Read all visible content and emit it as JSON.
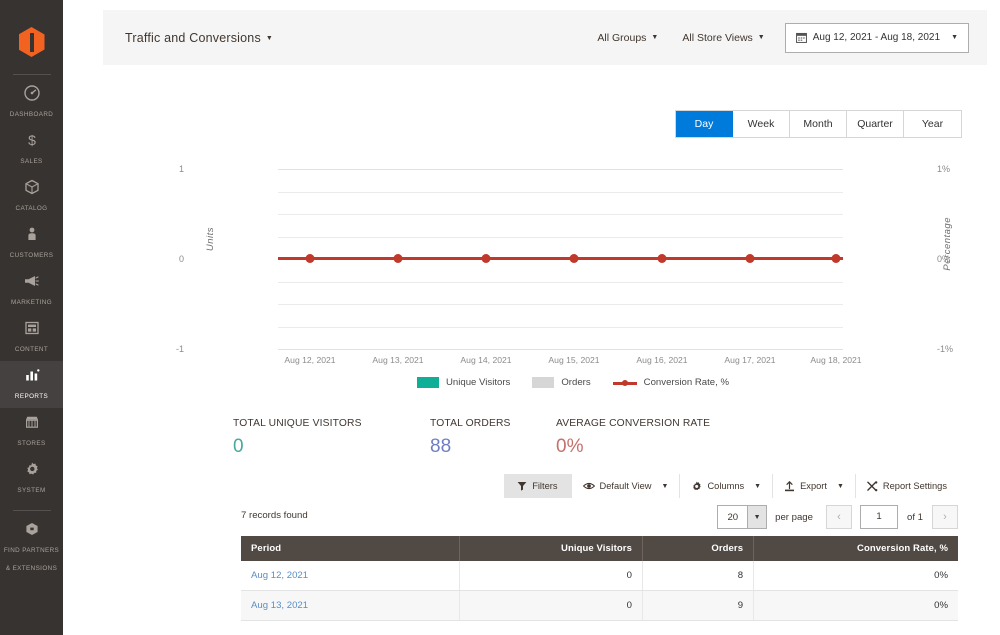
{
  "sidebar": {
    "logo": "magento-logo",
    "items": [
      {
        "label": "DASHBOARD",
        "icon": "dashboard-icon",
        "active": false
      },
      {
        "label": "SALES",
        "icon": "sales-icon",
        "active": false
      },
      {
        "label": "CATALOG",
        "icon": "catalog-icon",
        "active": false
      },
      {
        "label": "CUSTOMERS",
        "icon": "customers-icon",
        "active": false
      },
      {
        "label": "MARKETING",
        "icon": "marketing-icon",
        "active": false
      },
      {
        "label": "CONTENT",
        "icon": "content-icon",
        "active": false
      },
      {
        "label": "REPORTS",
        "icon": "reports-icon",
        "active": true
      },
      {
        "label": "STORES",
        "icon": "stores-icon",
        "active": false
      },
      {
        "label": "SYSTEM",
        "icon": "system-icon",
        "active": false
      },
      {
        "label": "FIND PARTNERS\n& EXTENSIONS",
        "icon": "partners-icon",
        "active": false
      }
    ]
  },
  "header": {
    "title": "Traffic and Conversions",
    "groups_label": "All Groups",
    "store_views_label": "All Store Views",
    "date_range": "Aug 12, 2021 - Aug 18, 2021",
    "calendar_icon": "calendar-icon"
  },
  "period_tabs": {
    "items": [
      "Day",
      "Week",
      "Month",
      "Quarter",
      "Year"
    ],
    "selected": "Day"
  },
  "chart_data": {
    "type": "line",
    "title": "",
    "xlabel": "",
    "ylabel": "Units",
    "y2label": "Percentage",
    "categories": [
      "Aug 12, 2021",
      "Aug 13, 2021",
      "Aug 14, 2021",
      "Aug 15, 2021",
      "Aug 16, 2021",
      "Aug 17, 2021",
      "Aug 18, 2021"
    ],
    "yticks": [
      "1",
      "0",
      "-1"
    ],
    "y2ticks": [
      "1%",
      "0%",
      "-1%"
    ],
    "ylim": [
      -1,
      1
    ],
    "y2lim": [
      -1,
      1
    ],
    "grid": true,
    "legend_position": "bottom",
    "series": [
      {
        "name": "Unique Visitors",
        "type": "bar",
        "color": "#0fae96",
        "values": [
          0,
          0,
          0,
          0,
          0,
          0,
          0
        ]
      },
      {
        "name": "Orders",
        "type": "bar",
        "color": "#d6d6d6",
        "values": [
          0,
          0,
          0,
          0,
          0,
          0,
          0
        ]
      },
      {
        "name": "Conversion Rate, %",
        "type": "line",
        "color": "#c0392b",
        "values": [
          0,
          0,
          0,
          0,
          0,
          0,
          0
        ]
      }
    ]
  },
  "totals": [
    {
      "label": "TOTAL UNIQUE VISITORS",
      "value": "0",
      "color": "#4aa89a"
    },
    {
      "label": "TOTAL ORDERS",
      "value": "88",
      "color": "#6f7ec4"
    },
    {
      "label": "AVERAGE CONVERSION RATE",
      "value": "0%",
      "color": "#c4716c"
    }
  ],
  "toolbar": {
    "filters_label": "Filters",
    "filters_icon": "funnel-icon",
    "view_label": "Default View",
    "view_icon": "eye-icon",
    "columns_label": "Columns",
    "columns_icon": "gear-icon",
    "export_label": "Export",
    "export_icon": "export-icon",
    "settings_label": "Report Settings",
    "settings_icon": "tools-icon"
  },
  "grid_controls": {
    "records_found": "7 records found",
    "per_page_value": "20",
    "per_page_label": "per page",
    "prev_icon": "chevron-left-icon",
    "next_icon": "chevron-right-icon",
    "current_page": "1",
    "of_label": "of 1"
  },
  "table": {
    "columns": [
      "Period",
      "Unique Visitors",
      "Orders",
      "Conversion Rate, %"
    ],
    "rows": [
      {
        "period": "Aug 12, 2021",
        "unique_visitors": "0",
        "orders": "8",
        "conversion_rate": "0%"
      },
      {
        "period": "Aug 13, 2021",
        "unique_visitors": "0",
        "orders": "9",
        "conversion_rate": "0%"
      }
    ]
  }
}
